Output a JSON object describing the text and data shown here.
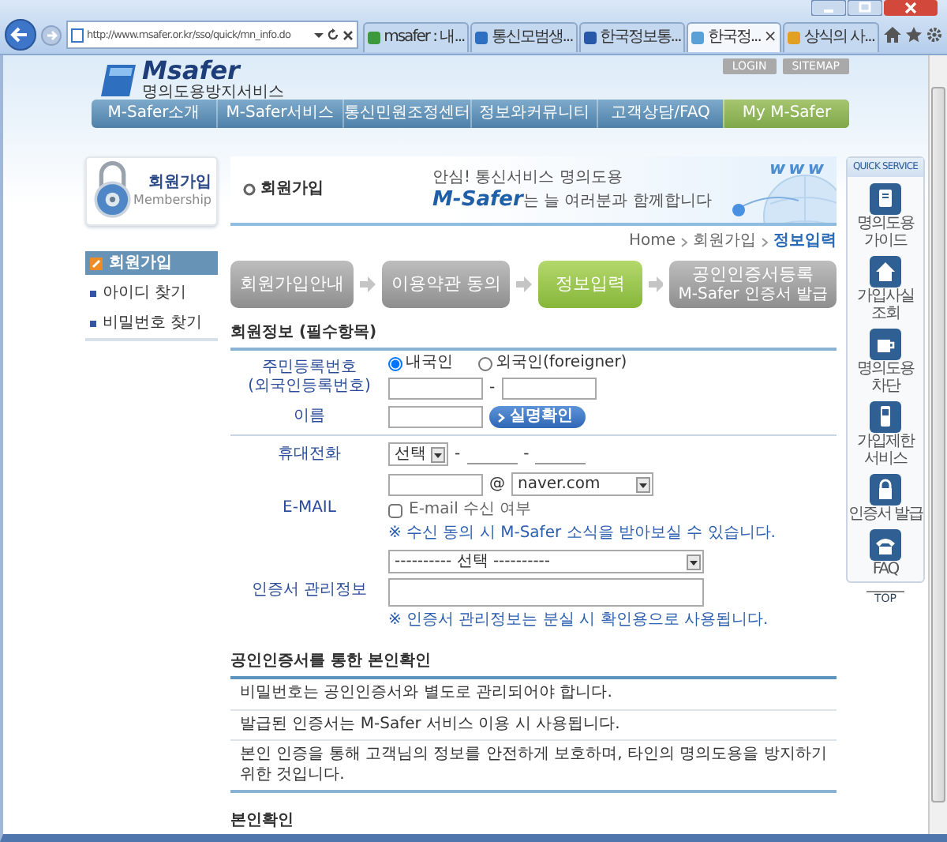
{
  "browser": {
    "address": "http://www.msafer.or.kr/sso/quick/mn_info.do",
    "tab_close": "×",
    "tabs": [
      {
        "label": "msafer : 내...",
        "selected": false
      },
      {
        "label": "통신모범생...",
        "selected": false
      },
      {
        "label": "한국정보통...",
        "selected": false
      },
      {
        "label": "한국정...",
        "selected": true
      },
      {
        "label": "상식의 사...",
        "selected": false
      }
    ]
  },
  "header": {
    "logo": "Msafer",
    "logo_sub": "명의도용방지서비스",
    "top_links": [
      "LOGIN",
      "SITEMAP"
    ],
    "nav": [
      {
        "label": "M-Safer소개",
        "selected": false
      },
      {
        "label": "M-Safer서비스",
        "selected": false
      },
      {
        "label": "통신민원조정센터",
        "selected": false
      },
      {
        "label": "정보와커뮤니티",
        "selected": false
      },
      {
        "label": "고객상담/FAQ",
        "selected": false
      },
      {
        "label": "My M-Safer",
        "selected": true
      }
    ]
  },
  "side": {
    "title": "회원가입",
    "subtitle": "Membership",
    "menu": [
      {
        "label": "회원가입",
        "selected": true
      },
      {
        "label": "아이디 찾기",
        "selected": false
      },
      {
        "label": "비밀번호 찾기",
        "selected": false
      }
    ]
  },
  "main": {
    "title": "회원가입",
    "banner": {
      "line1": "안심! 통신서비스 명의도용",
      "brand": "M-Safer",
      "line2": "는 늘 여러분과 함께합니다",
      "deco": "www"
    },
    "breadcrumb": [
      "Home",
      "회원가입",
      "정보입력"
    ],
    "steps": [
      {
        "label": "회원가입안내",
        "selected": false
      },
      {
        "label": "이용약관 동의",
        "selected": false
      },
      {
        "label": "정보입력",
        "selected": true
      },
      {
        "label": "공인인증서등록",
        "sub": "M-Safer 인증서 발급",
        "selected": false
      }
    ],
    "form": {
      "title": "회원정보 (필수항목)",
      "id_row": {
        "labels": [
          "주민등록번호",
          "(외국인등록번호)"
        ],
        "radios": [
          {
            "label": "내국인",
            "selected": true
          },
          {
            "label": "외국인(foreigner)",
            "selected": false
          }
        ],
        "separator": "-"
      },
      "name_row": {
        "label": "이름",
        "button": "실명확인"
      },
      "phone_row": {
        "label": "휴대전화",
        "carrier": "선택",
        "separator": "-"
      },
      "email_row": {
        "label": "E-MAIL",
        "at": "@",
        "domain": "naver.com",
        "checkbox": {
          "label": "E-mail 수신 여부",
          "checked": false
        },
        "note": "※ 수신 동의 시 M-Safer 소식을 받아보실 수 있습니다."
      },
      "cert_row": {
        "label": "인증서 관리정보",
        "select": "---------- 선택 ----------",
        "note": "※ 인증서 관리정보는 분실 시 확인용으로 사용됩니다."
      }
    },
    "cert_check": {
      "title": "공인인증서를 통한 본인확인",
      "paragraphs": [
        "비밀번호는 공인인증서와 별도로 관리되어야 합니다.",
        "발급된 인증서는 M-Safer 서비스 이용 시 사용됩니다.",
        "본인 인증을 통해 고객님의 정보를 안전하게 보호하며, 타인의 명의도용을 방지하기 위한 것입니다."
      ]
    },
    "verify": {
      "title": "본인확인"
    }
  },
  "quick": {
    "title": "QUICK SERVICE",
    "items": [
      "명의도용 가이드",
      "가입사실 조회",
      "명의도용 차단",
      "가입제한 서비스",
      "인증서 발급",
      "FAQ"
    ],
    "top": "TOP"
  }
}
